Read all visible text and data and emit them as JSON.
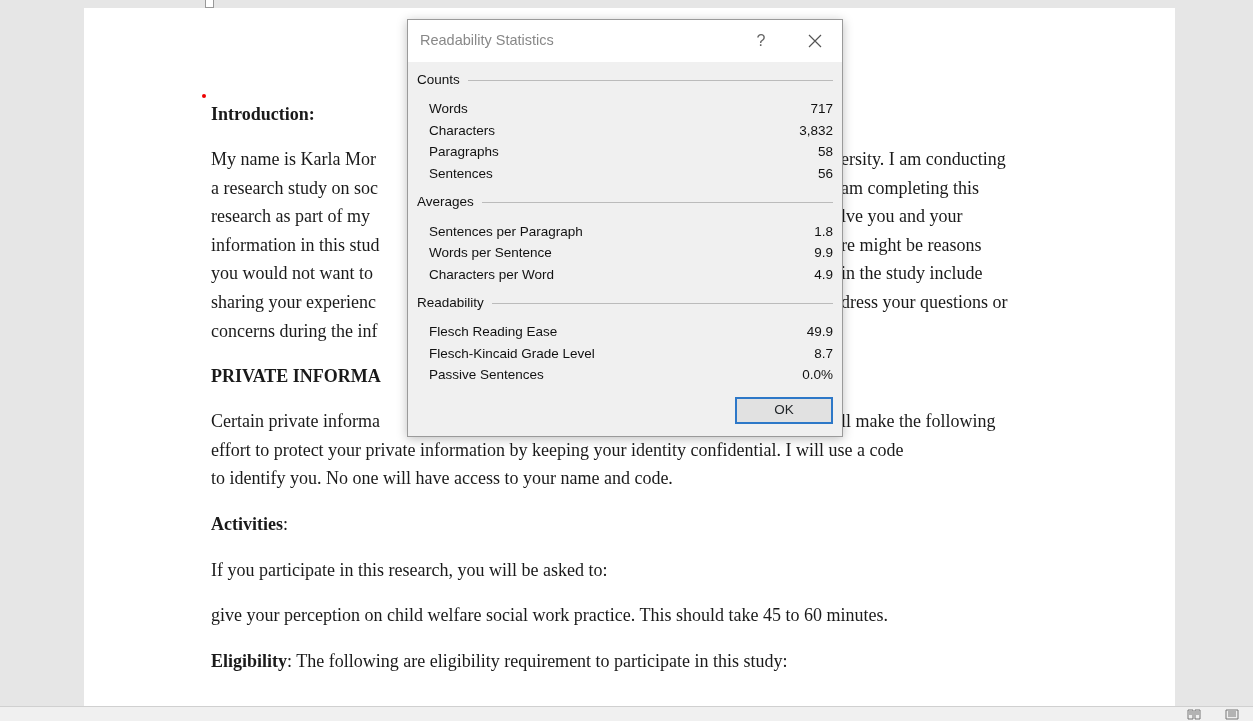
{
  "document": {
    "blocks": [
      {
        "kind": "heading",
        "text": "Introduction:"
      },
      {
        "kind": "para",
        "lines": [
          {
            "left": "My name is Karla Mor",
            "right": "ersity. I am conducting"
          },
          {
            "left": "a research study on soc",
            "right": "am completing this"
          },
          {
            "left": "research as part of my",
            "right": "lve you and your"
          },
          {
            "left": "information in this stud",
            "right": "re might be reasons"
          },
          {
            "left": "you would not want to",
            "right": "in the study include"
          },
          {
            "left": "sharing your experienc",
            "right": "dress your questions or"
          },
          {
            "left": "concerns during the inf"
          }
        ]
      },
      {
        "kind": "heading",
        "text": "PRIVATE INFORMA"
      },
      {
        "kind": "para",
        "lines": [
          {
            "left": "Certain private informa",
            "right": "ll make the following"
          },
          {
            "text": "effort to protect your private information by keeping your identity confidential. I will use a code"
          },
          {
            "text": "to identify you. No one will have access to your name and code."
          }
        ]
      },
      {
        "kind": "para",
        "lines": [
          {
            "text": "**Activities**:"
          }
        ]
      },
      {
        "kind": "para",
        "lines": [
          {
            "text": "If you participate in this research, you will be asked to:"
          }
        ]
      },
      {
        "kind": "para",
        "lines": [
          {
            "text": "give your perception on child welfare social work practice. This should take 45 to 60 minutes."
          }
        ]
      },
      {
        "kind": "para",
        "lines": [
          {
            "text": "**Eligibility**: The following are eligibility requirement to participate in this study:"
          }
        ]
      }
    ]
  },
  "dialog": {
    "title": "Readability Statistics",
    "help": "?",
    "sections": [
      {
        "title": "Counts",
        "rows": [
          {
            "label": "Words",
            "value": "717"
          },
          {
            "label": "Characters",
            "value": "3,832"
          },
          {
            "label": "Paragraphs",
            "value": "58"
          },
          {
            "label": "Sentences",
            "value": "56"
          }
        ]
      },
      {
        "title": "Averages",
        "rows": [
          {
            "label": "Sentences per Paragraph",
            "value": "1.8"
          },
          {
            "label": "Words per Sentence",
            "value": "9.9"
          },
          {
            "label": "Characters per Word",
            "value": "4.9"
          }
        ]
      },
      {
        "title": "Readability",
        "rows": [
          {
            "label": "Flesch Reading Ease",
            "value": "49.9"
          },
          {
            "label": "Flesch-Kincaid Grade Level",
            "value": "8.7"
          },
          {
            "label": "Passive Sentences",
            "value": "0.0%"
          }
        ]
      }
    ],
    "button": "OK"
  }
}
